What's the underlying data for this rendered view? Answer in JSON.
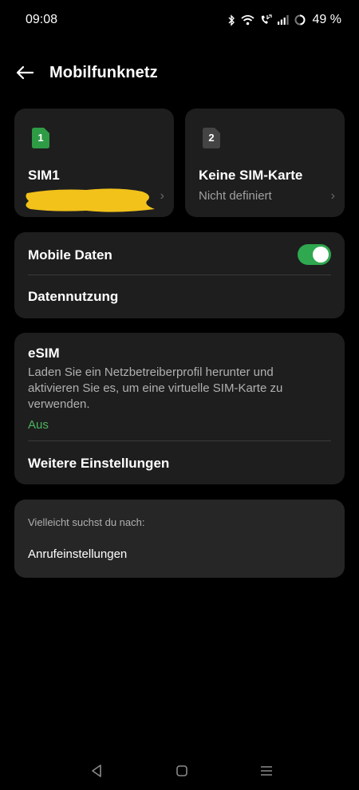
{
  "status_bar": {
    "time": "09:08",
    "battery": "49 %",
    "icons": [
      "bluetooth-icon",
      "wifi-icon",
      "volte-call-icon",
      "signal-icon",
      "battery-icon"
    ]
  },
  "header": {
    "title": "Mobilfunknetz",
    "back_icon": "arrow-left-icon"
  },
  "sim_cards": [
    {
      "slot": "1",
      "name": "SIM1",
      "subtitle": "",
      "color": "#2e9b45"
    },
    {
      "slot": "2",
      "name": "Keine SIM-Karte",
      "subtitle": "Nicht definiert",
      "color": "#444444"
    }
  ],
  "data_section": {
    "mobile_data_label": "Mobile Daten",
    "mobile_data_enabled": true,
    "data_usage_label": "Datennutzung"
  },
  "esim_section": {
    "title": "eSIM",
    "description": "Laden Sie ein Netzbetreiberprofil herunter und aktivieren Sie es, um eine virtuelle SIM-Karte zu verwenden.",
    "status": "Aus",
    "more_settings": "Weitere Einstellungen"
  },
  "suggestions": {
    "heading": "Vielleicht suchst du nach:",
    "item": "Anrufeinstellungen"
  },
  "nav_bar": {
    "icons": [
      "back-triangle-icon",
      "home-square-icon",
      "recents-menu-icon"
    ]
  },
  "colors": {
    "accent_green": "#2fa84f",
    "card_bg": "#1e1e1e",
    "redaction_yellow": "#f2c21a"
  }
}
